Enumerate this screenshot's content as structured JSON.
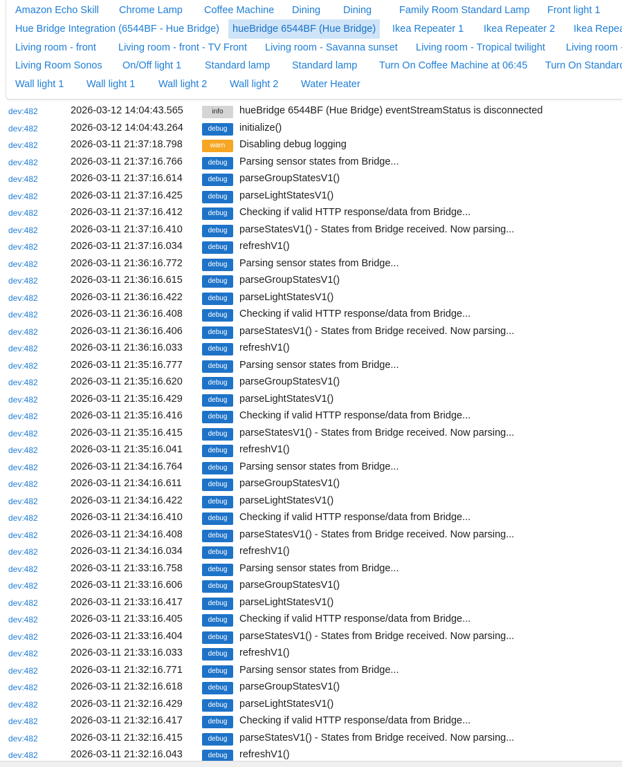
{
  "filters": [
    [
      "Amazon Echo Skill",
      "Chrome Lamp",
      "Coffee Machine",
      "Dining",
      "Dining",
      "Family Room Standard Lamp",
      "Front light 1"
    ],
    [
      "Hue Bridge Integration (6544BF - Hue Bridge)",
      "hueBridge 6544BF (Hue Bridge)",
      "Ikea Repeater 1",
      "Ikea Repeater 2",
      "Ikea Repea"
    ],
    [
      "Living room - front",
      "Living room - front - TV Front",
      "Living room - Savanna sunset",
      "Living room - Tropical twilight",
      "Living room -"
    ],
    [
      "Living Room Sonos",
      "On/Off light 1",
      "Standard lamp",
      "Standard lamp",
      "Turn On Coffee Machine at 06:45",
      "Turn On Standard"
    ],
    [
      "Wall light 1",
      "Wall light 1",
      "Wall light 2",
      "Wall light 2",
      "Water Heater"
    ]
  ],
  "active_filter": "hueBridge 6544BF (Hue Bridge)",
  "level_colors": {
    "info": "#d5d5d5",
    "debug": "#1e73c8",
    "warn": "#f6a623"
  },
  "log": [
    {
      "dev": "dev:482",
      "time": "2026-03-12 14:04:43.565",
      "level": "info",
      "msg": "hueBridge 6544BF (Hue Bridge) eventStreamStatus is disconnected"
    },
    {
      "dev": "dev:482",
      "time": "2026-03-12 14:04:43.264",
      "level": "debug",
      "msg": "initialize()"
    },
    {
      "dev": "dev:482",
      "time": "2026-03-11 21:37:18.798",
      "level": "warn",
      "msg": "Disabling debug logging"
    },
    {
      "dev": "dev:482",
      "time": "2026-03-11 21:37:16.766",
      "level": "debug",
      "msg": "Parsing sensor states from Bridge..."
    },
    {
      "dev": "dev:482",
      "time": "2026-03-11 21:37:16.614",
      "level": "debug",
      "msg": "parseGroupStatesV1()"
    },
    {
      "dev": "dev:482",
      "time": "2026-03-11 21:37:16.425",
      "level": "debug",
      "msg": "parseLightStatesV1()"
    },
    {
      "dev": "dev:482",
      "time": "2026-03-11 21:37:16.412",
      "level": "debug",
      "msg": "Checking if valid HTTP response/data from Bridge..."
    },
    {
      "dev": "dev:482",
      "time": "2026-03-11 21:37:16.410",
      "level": "debug",
      "msg": "parseStatesV1() - States from Bridge received. Now parsing..."
    },
    {
      "dev": "dev:482",
      "time": "2026-03-11 21:37:16.034",
      "level": "debug",
      "msg": "refreshV1()"
    },
    {
      "dev": "dev:482",
      "time": "2026-03-11 21:36:16.772",
      "level": "debug",
      "msg": "Parsing sensor states from Bridge..."
    },
    {
      "dev": "dev:482",
      "time": "2026-03-11 21:36:16.615",
      "level": "debug",
      "msg": "parseGroupStatesV1()"
    },
    {
      "dev": "dev:482",
      "time": "2026-03-11 21:36:16.422",
      "level": "debug",
      "msg": "parseLightStatesV1()"
    },
    {
      "dev": "dev:482",
      "time": "2026-03-11 21:36:16.408",
      "level": "debug",
      "msg": "Checking if valid HTTP response/data from Bridge..."
    },
    {
      "dev": "dev:482",
      "time": "2026-03-11 21:36:16.406",
      "level": "debug",
      "msg": "parseStatesV1() - States from Bridge received. Now parsing..."
    },
    {
      "dev": "dev:482",
      "time": "2026-03-11 21:36:16.033",
      "level": "debug",
      "msg": "refreshV1()"
    },
    {
      "dev": "dev:482",
      "time": "2026-03-11 21:35:16.777",
      "level": "debug",
      "msg": "Parsing sensor states from Bridge..."
    },
    {
      "dev": "dev:482",
      "time": "2026-03-11 21:35:16.620",
      "level": "debug",
      "msg": "parseGroupStatesV1()"
    },
    {
      "dev": "dev:482",
      "time": "2026-03-11 21:35:16.429",
      "level": "debug",
      "msg": "parseLightStatesV1()"
    },
    {
      "dev": "dev:482",
      "time": "2026-03-11 21:35:16.416",
      "level": "debug",
      "msg": "Checking if valid HTTP response/data from Bridge..."
    },
    {
      "dev": "dev:482",
      "time": "2026-03-11 21:35:16.415",
      "level": "debug",
      "msg": "parseStatesV1() - States from Bridge received. Now parsing..."
    },
    {
      "dev": "dev:482",
      "time": "2026-03-11 21:35:16.041",
      "level": "debug",
      "msg": "refreshV1()"
    },
    {
      "dev": "dev:482",
      "time": "2026-03-11 21:34:16.764",
      "level": "debug",
      "msg": "Parsing sensor states from Bridge..."
    },
    {
      "dev": "dev:482",
      "time": "2026-03-11 21:34:16.611",
      "level": "debug",
      "msg": "parseGroupStatesV1()"
    },
    {
      "dev": "dev:482",
      "time": "2026-03-11 21:34:16.422",
      "level": "debug",
      "msg": "parseLightStatesV1()"
    },
    {
      "dev": "dev:482",
      "time": "2026-03-11 21:34:16.410",
      "level": "debug",
      "msg": "Checking if valid HTTP response/data from Bridge..."
    },
    {
      "dev": "dev:482",
      "time": "2026-03-11 21:34:16.408",
      "level": "debug",
      "msg": "parseStatesV1() - States from Bridge received. Now parsing..."
    },
    {
      "dev": "dev:482",
      "time": "2026-03-11 21:34:16.034",
      "level": "debug",
      "msg": "refreshV1()"
    },
    {
      "dev": "dev:482",
      "time": "2026-03-11 21:33:16.758",
      "level": "debug",
      "msg": "Parsing sensor states from Bridge..."
    },
    {
      "dev": "dev:482",
      "time": "2026-03-11 21:33:16.606",
      "level": "debug",
      "msg": "parseGroupStatesV1()"
    },
    {
      "dev": "dev:482",
      "time": "2026-03-11 21:33:16.417",
      "level": "debug",
      "msg": "parseLightStatesV1()"
    },
    {
      "dev": "dev:482",
      "time": "2026-03-11 21:33:16.405",
      "level": "debug",
      "msg": "Checking if valid HTTP response/data from Bridge..."
    },
    {
      "dev": "dev:482",
      "time": "2026-03-11 21:33:16.404",
      "level": "debug",
      "msg": "parseStatesV1() - States from Bridge received. Now parsing..."
    },
    {
      "dev": "dev:482",
      "time": "2026-03-11 21:33:16.033",
      "level": "debug",
      "msg": "refreshV1()"
    },
    {
      "dev": "dev:482",
      "time": "2026-03-11 21:32:16.771",
      "level": "debug",
      "msg": "Parsing sensor states from Bridge..."
    },
    {
      "dev": "dev:482",
      "time": "2026-03-11 21:32:16.618",
      "level": "debug",
      "msg": "parseGroupStatesV1()"
    },
    {
      "dev": "dev:482",
      "time": "2026-03-11 21:32:16.429",
      "level": "debug",
      "msg": "parseLightStatesV1()"
    },
    {
      "dev": "dev:482",
      "time": "2026-03-11 21:32:16.417",
      "level": "debug",
      "msg": "Checking if valid HTTP response/data from Bridge..."
    },
    {
      "dev": "dev:482",
      "time": "2026-03-11 21:32:16.415",
      "level": "debug",
      "msg": "parseStatesV1() - States from Bridge received. Now parsing..."
    },
    {
      "dev": "dev:482",
      "time": "2026-03-11 21:32:16.043",
      "level": "debug",
      "msg": "refreshV1()"
    }
  ]
}
